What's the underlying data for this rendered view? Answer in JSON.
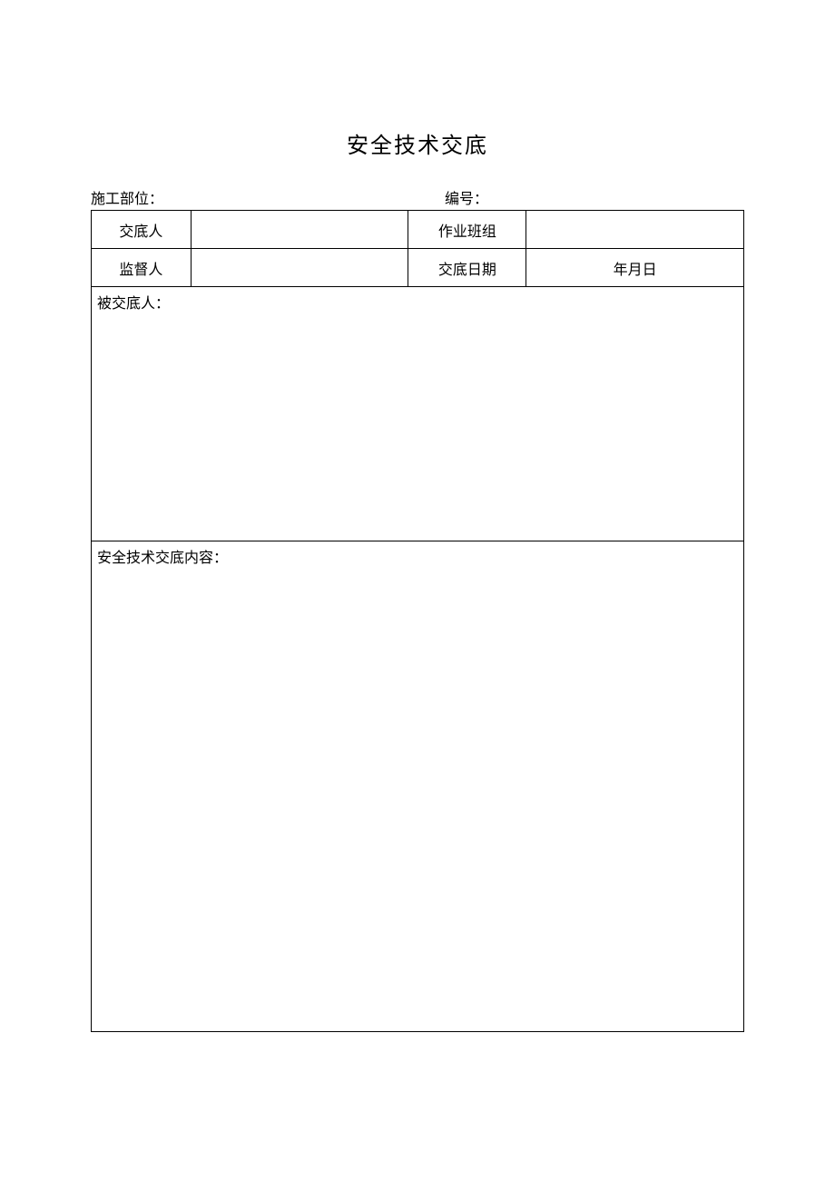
{
  "title": "安全技术交底",
  "header": {
    "construction_section_label": "施工部位：",
    "construction_section_value": "",
    "number_label": "编号：",
    "number_value": ""
  },
  "rows": {
    "presenter_label": "交底人",
    "presenter_value": "",
    "work_team_label": "作业班组",
    "work_team_value": "",
    "supervisor_label": "监督人",
    "supervisor_value": "",
    "disclosure_date_label": "交底日期",
    "disclosure_date_value": "年月日"
  },
  "sections": {
    "recipients_label": "被交底人：",
    "recipients_value": "",
    "content_label": "安全技术交底内容：",
    "content_value": ""
  }
}
